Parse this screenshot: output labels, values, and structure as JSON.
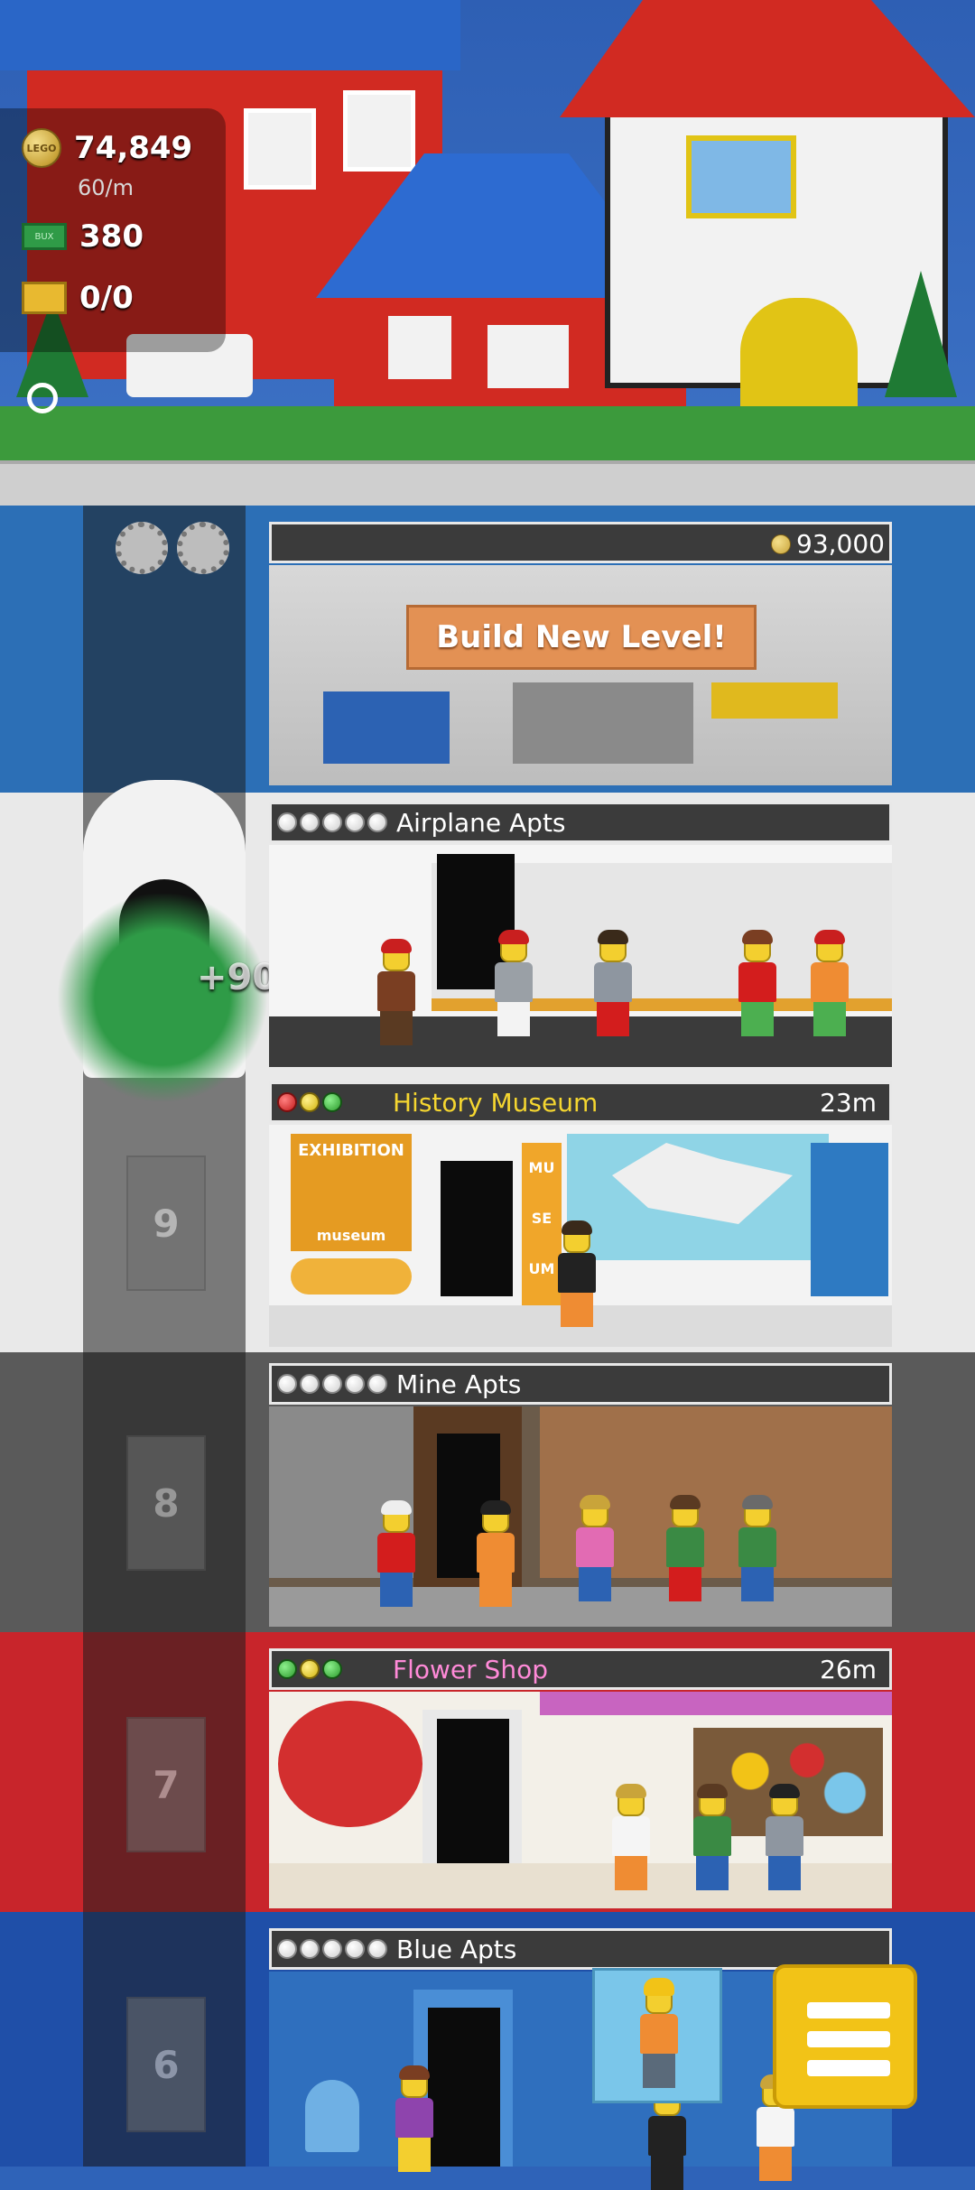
{
  "hud": {
    "coins_value": "74,849",
    "coins_rate": "60/m",
    "bux_value": "380",
    "storage_value": "0/0",
    "coin_icon_text": "LEGO",
    "bux_icon_text": "BUX"
  },
  "build_level": {
    "cost": "93,000",
    "button_label": "Build New Level!"
  },
  "cash_popup": "+90",
  "floors": [
    {
      "name": "Airplane Apts",
      "timer": "",
      "number": "",
      "status": [
        "white",
        "white",
        "white",
        "white",
        "white"
      ]
    },
    {
      "name": "History Museum",
      "timer": "23m",
      "number": "9",
      "status": [
        "red",
        "yellow",
        "green"
      ]
    },
    {
      "name": "Mine Apts",
      "timer": "",
      "number": "8",
      "status": [
        "white",
        "white",
        "white",
        "white",
        "white"
      ]
    },
    {
      "name": "Flower Shop",
      "timer": "26m",
      "number": "7",
      "status": [
        "green",
        "yellow",
        "green"
      ]
    },
    {
      "name": "Blue Apts",
      "timer": "",
      "number": "6",
      "status": [
        "white",
        "white",
        "white",
        "white",
        "white"
      ]
    }
  ],
  "museum_signs": {
    "exhibition": "EXHIBITION",
    "museum": "museum",
    "mu": "MU",
    "se": "SE",
    "um": "UM"
  },
  "colors": {
    "history_museum_title": "#f5d630",
    "flower_shop_title": "#ff8ad8",
    "sky": "#2f63b8"
  }
}
